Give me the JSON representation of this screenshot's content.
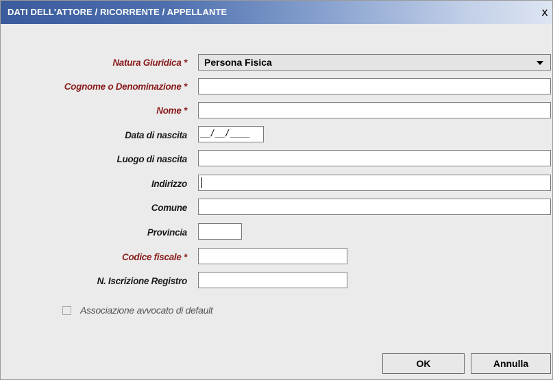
{
  "window": {
    "title": "DATI DELL'ATTORE / RICORRENTE / APPELLANTE",
    "close_glyph": "x"
  },
  "form": {
    "natura_giuridica": {
      "label": "Natura Giuridica *",
      "value": "Persona Fisica"
    },
    "cognome": {
      "label": "Cognome o Denominazione *",
      "value": ""
    },
    "nome": {
      "label": "Nome *",
      "value": ""
    },
    "data_nascita": {
      "label": "Data di nascita",
      "value": "__/__/____"
    },
    "luogo_nascita": {
      "label": "Luogo di nascita",
      "value": ""
    },
    "indirizzo": {
      "label": "Indirizzo",
      "value": ""
    },
    "comune": {
      "label": "Comune",
      "value": ""
    },
    "provincia": {
      "label": "Provincia",
      "value": ""
    },
    "codice_fiscale": {
      "label": "Codice fiscale *",
      "value": ""
    },
    "n_iscrizione": {
      "label": "N. Iscrizione Registro",
      "value": ""
    },
    "associazione": {
      "label": "Associazione avvocato di default",
      "checked": false
    }
  },
  "buttons": {
    "ok": "OK",
    "annulla": "Annulla"
  },
  "colors": {
    "required_label": "#8a1c1c",
    "title_bar_start": "#3a5b9c",
    "dialog_bg": "#ebebeb"
  }
}
